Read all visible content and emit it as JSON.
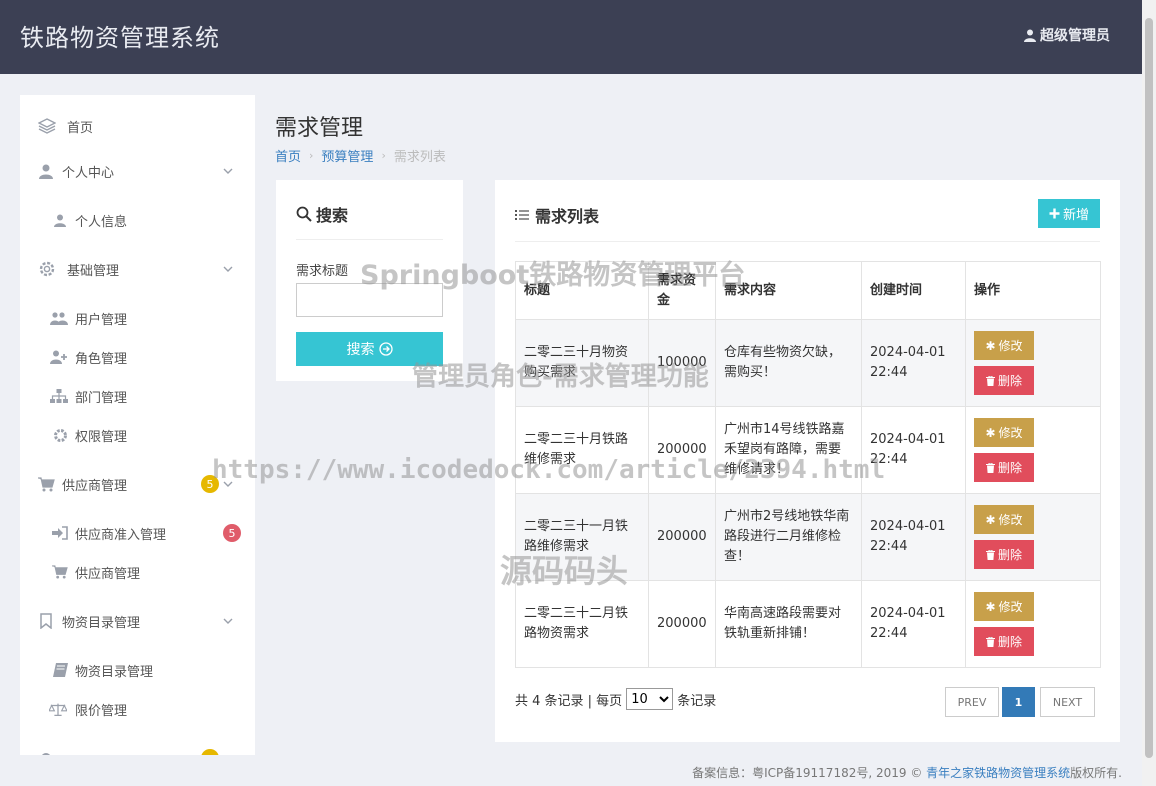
{
  "header": {
    "title": "铁路物资管理系统",
    "user": "超级管理员"
  },
  "sidebar": {
    "items": [
      {
        "label": "首页",
        "icon": "layers-icon"
      },
      {
        "label": "个人中心",
        "icon": "user-icon"
      },
      {
        "label": "个人信息",
        "icon": "user-icon"
      },
      {
        "label": "基础管理",
        "icon": "gear-icon"
      },
      {
        "label": "用户管理",
        "icon": "users-icon"
      },
      {
        "label": "角色管理",
        "icon": "user-plus-icon"
      },
      {
        "label": "部门管理",
        "icon": "sitemap-icon"
      },
      {
        "label": "权限管理",
        "icon": "cog-icon"
      },
      {
        "label": "供应商管理",
        "icon": "cart-icon",
        "badge": "5"
      },
      {
        "label": "供应商准入管理",
        "icon": "sign-in-icon",
        "badge": "5"
      },
      {
        "label": "供应商管理",
        "icon": "cart-icon"
      },
      {
        "label": "物资目录管理",
        "icon": "bookmark-icon"
      },
      {
        "label": "物资目录管理",
        "icon": "book-icon"
      },
      {
        "label": "限价管理",
        "icon": "balance-scale-icon"
      }
    ]
  },
  "page": {
    "title": "需求管理",
    "breadcrumb": {
      "home": "首页",
      "section": "预算管理",
      "current": "需求列表"
    }
  },
  "search": {
    "title": "搜索",
    "field_label": "需求标题",
    "field_value": "",
    "button": "搜索"
  },
  "list": {
    "title": "需求列表",
    "add_button": "新增",
    "columns": [
      "标题",
      "需求资金",
      "需求内容",
      "创建时间",
      "操作"
    ],
    "rows": [
      {
        "title": "二零二三十月物资购买需求",
        "amount": "100000",
        "content": "仓库有些物资欠缺，需购买！",
        "created": "2024-04-01 22:44"
      },
      {
        "title": "二零二三十月铁路维修需求",
        "amount": "200000",
        "content": "广州市14号线铁路嘉禾望岗有路障，需要维修请求！",
        "created": "2024-04-01 22:44"
      },
      {
        "title": "二零二三十一月铁路维修需求",
        "amount": "200000",
        "content": "广州市2号线地铁华南路段进行二月维修检查！",
        "created": "2024-04-01 22:44"
      },
      {
        "title": "二零二三十二月铁路物资需求",
        "amount": "200000",
        "content": "华南高速路段需要对铁轨重新排铺！",
        "created": "2024-04-01 22:44"
      }
    ],
    "edit_label": "修改",
    "delete_label": "删除"
  },
  "pager": {
    "total_prefix": "共 4 条记录 | 每页",
    "page_size": "10",
    "suffix": "条记录",
    "prev": "PREV",
    "current": "1",
    "next": "NEXT"
  },
  "footer": {
    "prefix": "备案信息：粤ICP备19117182号, 2019 ©",
    "owner": "青年之家铁路物资管理系统",
    "suffix": "版权所有."
  },
  "watermarks": {
    "platform": "Springboot铁路物资管理平台",
    "feature": "管理员角色-需求管理功能",
    "url": "https://www.icodedock.com/article/2394.html",
    "brand": "源码码头"
  },
  "colors": {
    "header": "#3c4054",
    "accent": "#36c5d3",
    "edit": "#c8a04a",
    "delete": "#e14d5c",
    "pager_active": "#337ab7"
  }
}
